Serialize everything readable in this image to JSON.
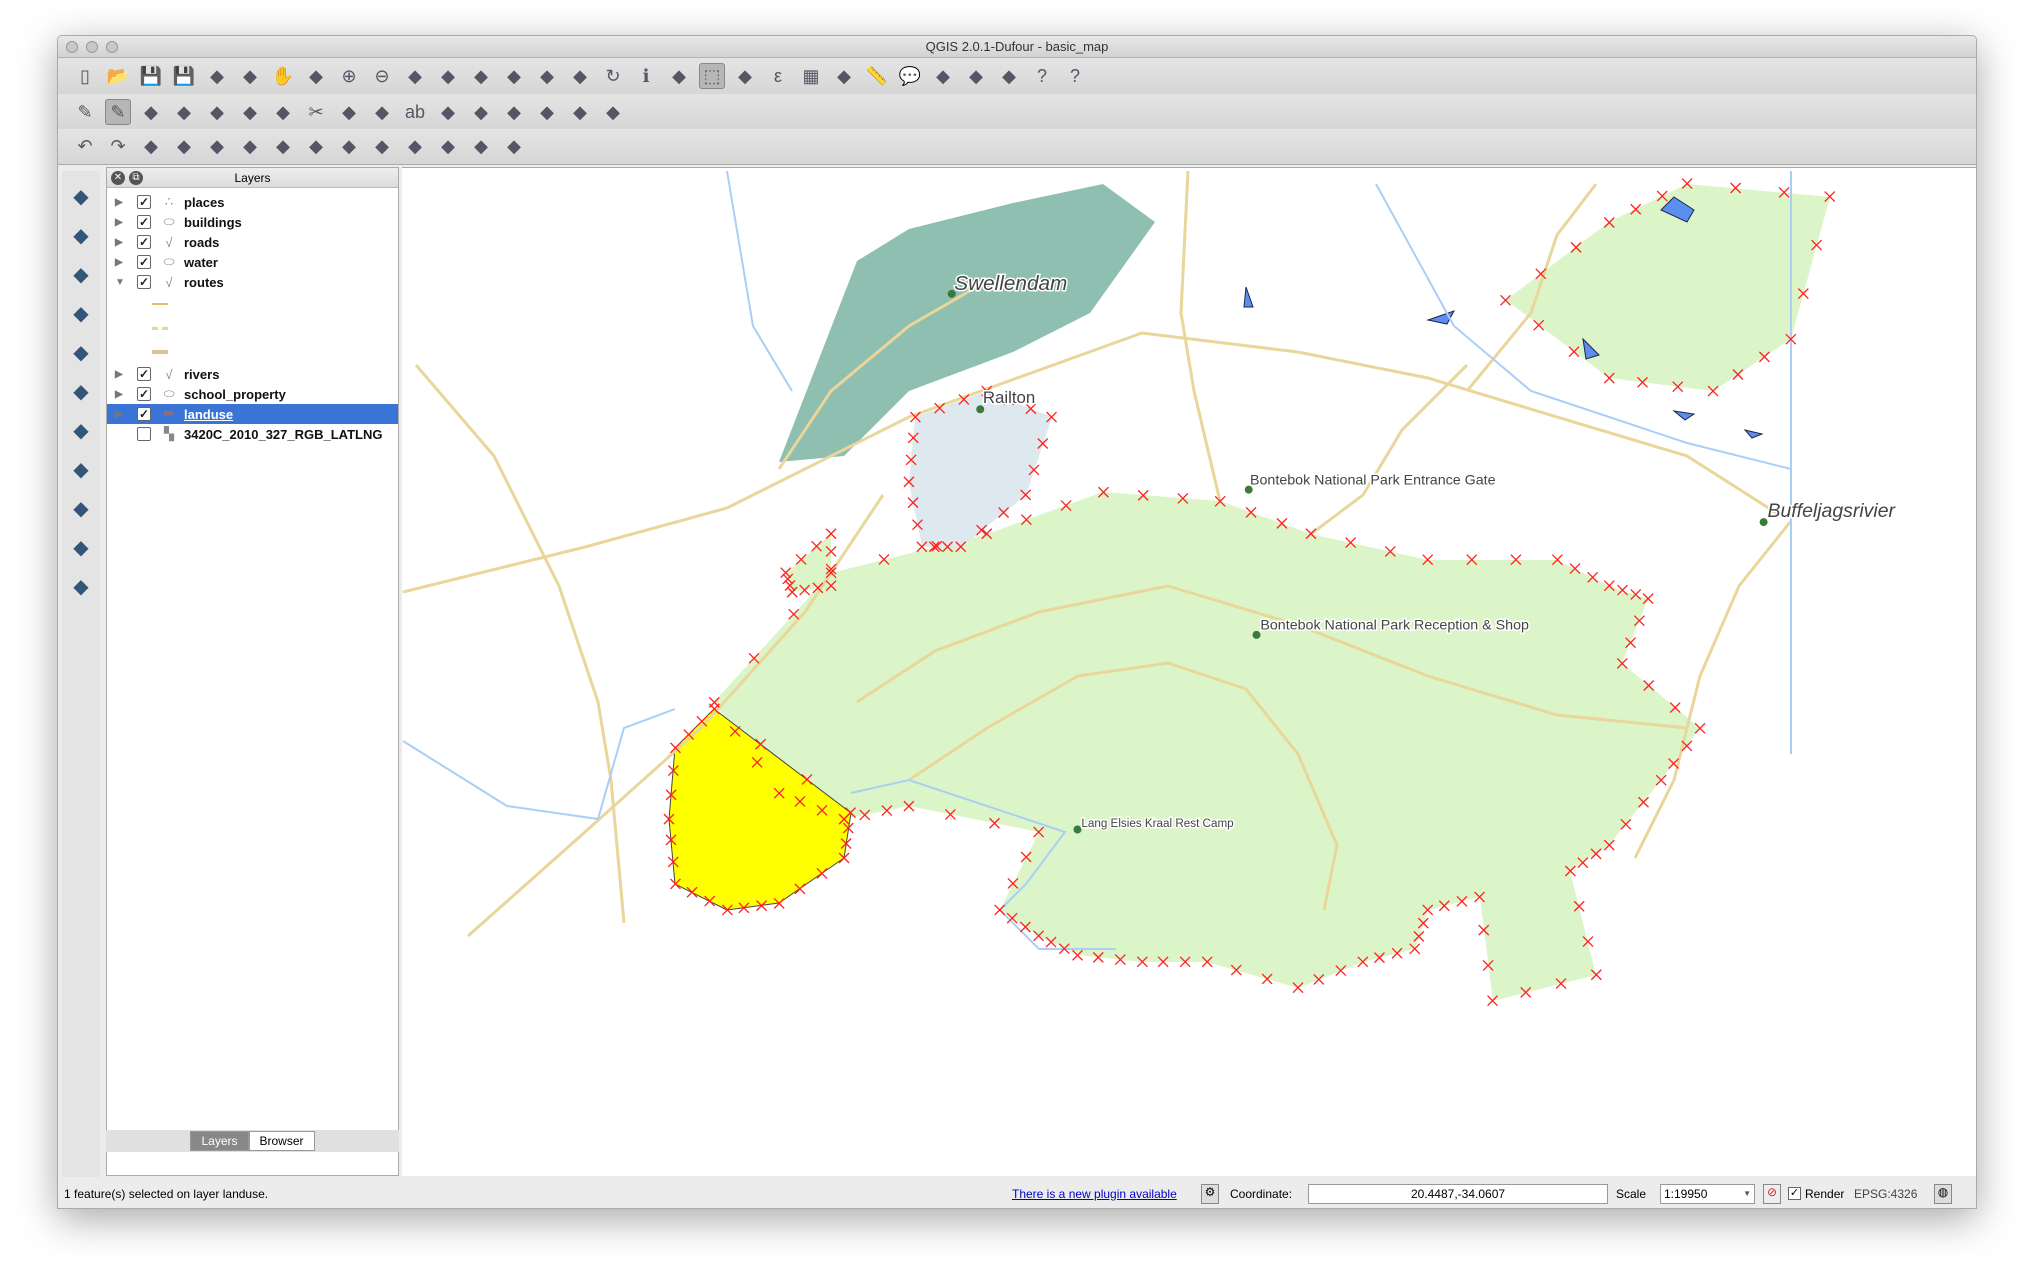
{
  "window": {
    "title": "QGIS 2.0.1-Dufour - basic_map"
  },
  "toolbar1": [
    "new-project-icon",
    "open-project-icon",
    "save-project-icon",
    "save-as-icon",
    "print-composer-icon",
    "composer-manager-icon",
    "pan-icon",
    "pan-to-selection-icon",
    "zoom-in-icon",
    "zoom-out-icon",
    "zoom-actual-icon",
    "zoom-full-icon",
    "zoom-selection-icon",
    "zoom-layer-icon",
    "zoom-last-icon",
    "zoom-next-icon",
    "refresh-icon",
    "identify-icon",
    "action-icon",
    "select-features-icon",
    "deselect-icon",
    "field-calculator-icon",
    "attribute-table-icon",
    "statistics-icon",
    "measure-icon",
    "map-tips-icon",
    "bookmark-icon",
    "new-bookmark-icon",
    "text-annotation-icon",
    "help-icon",
    "whats-this-icon"
  ],
  "toolbar2": [
    "current-edits-icon",
    "toggle-editing-icon",
    "save-edits-icon",
    "add-feature-icon",
    "move-feature-icon",
    "node-tool-icon",
    "delete-selected-icon",
    "cut-features-icon",
    "copy-features-icon",
    "paste-features-icon",
    "label-icon",
    "pin-labels-icon",
    "show-hide-labels-icon",
    "move-label-icon",
    "rotate-label-icon",
    "change-label-icon",
    "label-toolbar-icon"
  ],
  "toolbar3": [
    "undo-icon",
    "redo-icon",
    "simplify-feature-icon",
    "add-ring-icon",
    "add-part-icon",
    "fill-ring-icon",
    "delete-ring-icon",
    "delete-part-icon",
    "reshape-icon",
    "offset-curve-icon",
    "split-features-icon",
    "split-parts-icon",
    "merge-features-icon",
    "rotate-point-symbols-icon"
  ],
  "left_toolbar": [
    "add-vector-layer-icon",
    "add-raster-layer-icon",
    "add-postgis-layer-icon",
    "add-spatialite-layer-icon",
    "add-mssql-layer-icon",
    "add-wms-layer-icon",
    "add-wcs-layer-icon",
    "add-wfs-layer-icon",
    "add-delimited-text-icon",
    "new-shapefile-icon",
    "remove-layer-icon"
  ],
  "layers_panel": {
    "title": "Layers",
    "layers": [
      {
        "name": "places",
        "checked": true,
        "icon": "point-layer-icon",
        "expanded": false
      },
      {
        "name": "buildings",
        "checked": true,
        "icon": "polygon-layer-icon",
        "expanded": false
      },
      {
        "name": "roads",
        "checked": true,
        "icon": "line-layer-icon",
        "expanded": false
      },
      {
        "name": "water",
        "checked": true,
        "icon": "polygon-layer-icon",
        "expanded": false
      },
      {
        "name": "routes",
        "checked": true,
        "icon": "line-layer-icon",
        "expanded": true
      },
      {
        "name": "rivers",
        "checked": true,
        "icon": "line-layer-icon",
        "expanded": false
      },
      {
        "name": "school_property",
        "checked": true,
        "icon": "polygon-layer-icon",
        "expanded": false
      },
      {
        "name": "landuse",
        "checked": true,
        "icon": "editing-pencil-icon",
        "expanded": false,
        "selected": true
      },
      {
        "name": "3420C_2010_327_RGB_LATLNG",
        "checked": false,
        "icon": "raster-layer-icon",
        "expanded": false
      }
    ],
    "routes_legend_colors": [
      "#e8b86a",
      "#e9d39a",
      "#dcc594"
    ],
    "tabs": [
      "Layers",
      "Browser"
    ],
    "active_tab": "Layers"
  },
  "map": {
    "labels": {
      "swellendam": "Swellendam",
      "railton": "Railton",
      "entrance": "Bontebok National Park Entrance Gate",
      "reception": "Bontebok National Park Reception & Shop",
      "camp": "Lang Elsies Kraal Rest Camp",
      "buffel": "Buffeljagsrivier"
    },
    "colors": {
      "park": "#dcf5c8",
      "selected": "#ffff00",
      "town": "#8fbfb0",
      "suburb": "#dde9ee",
      "roads": "#e9d69a",
      "rivers": "#a9cff5",
      "water": "#5a8ef0",
      "vertex": "#ff2020"
    }
  },
  "status": {
    "message": "1 feature(s) selected on layer landuse.",
    "plugin_link": "There is a new plugin available",
    "coordinate_label": "Coordinate:",
    "coordinate": "20.4487,-34.0607",
    "scale_label": "Scale",
    "scale": "1:19950",
    "render_label": "Render",
    "render_checked": true,
    "crs": "EPSG:4326"
  }
}
